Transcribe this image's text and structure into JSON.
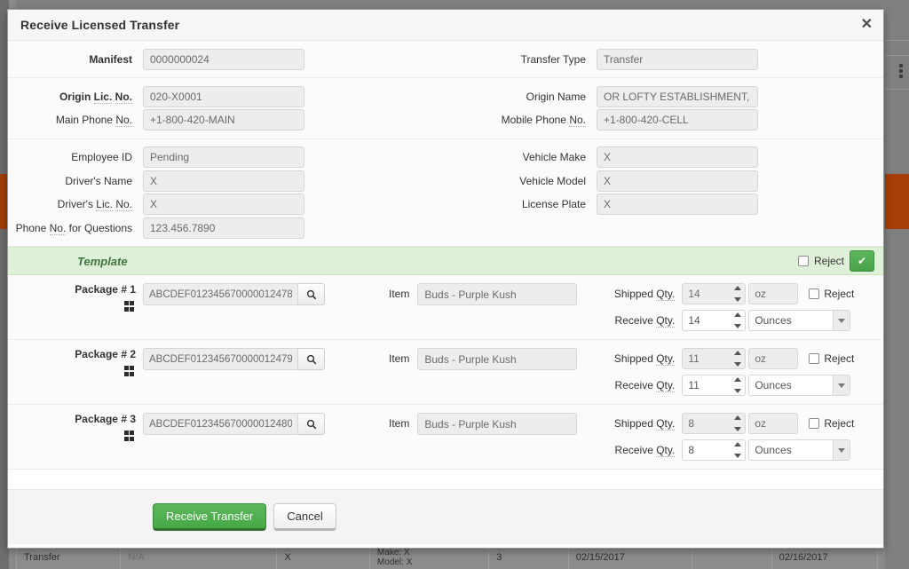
{
  "modal": {
    "title": "Receive Licensed Transfer",
    "close_label": "✕"
  },
  "form": {
    "rows": [
      {
        "left": [
          {
            "label": "Manifest",
            "bold": true,
            "value": "0000000024"
          }
        ],
        "right": [
          {
            "label": "Transfer Type",
            "bold": false,
            "value": "Transfer"
          }
        ]
      },
      {
        "left": [
          {
            "label": "Origin Lic. No.",
            "bold": true,
            "value": "020-X0001"
          },
          {
            "label": "Main Phone No.",
            "bold": false,
            "value": "+1-800-420-MAIN"
          }
        ],
        "right": [
          {
            "label": "Origin Name",
            "bold": false,
            "value": "OR LOFTY ESTABLISHMENT, LL"
          },
          {
            "label": "Mobile Phone No.",
            "bold": false,
            "value": "+1-800-420-CELL"
          }
        ]
      },
      {
        "left": [
          {
            "label": "Employee ID",
            "bold": false,
            "value": "Pending"
          },
          {
            "label": "Driver's Name",
            "bold": false,
            "value": "X"
          },
          {
            "label": "Driver's Lic. No.",
            "bold": false,
            "value": "X"
          },
          {
            "label": "Phone No. for Questions",
            "bold": false,
            "value": "123.456.7890"
          }
        ],
        "right": [
          {
            "label": "Vehicle Make",
            "bold": false,
            "value": "X"
          },
          {
            "label": "Vehicle Model",
            "bold": false,
            "value": "X"
          },
          {
            "label": "License Plate",
            "bold": false,
            "value": "X"
          }
        ]
      }
    ]
  },
  "template_bar": {
    "label": "Template",
    "reject_label": "Reject",
    "accept_icon": "✔",
    "accent_color": "#dff0d8",
    "accent_text_color": "#3c763d"
  },
  "packages": [
    {
      "number_label": "Package # 1",
      "tag_value": "ABCDEF012345670000012478",
      "search_icon": "search-icon",
      "item_label": "Item",
      "item_value": "Buds - Purple Kush",
      "shipped_label": "Shipped Qty.",
      "shipped_value": "14",
      "shipped_uom": "oz",
      "receive_label": "Receive Qty.",
      "receive_value": "14",
      "receive_uom": "Ounces",
      "reject_label": "Reject"
    },
    {
      "number_label": "Package # 2",
      "tag_value": "ABCDEF012345670000012479",
      "search_icon": "search-icon",
      "item_label": "Item",
      "item_value": "Buds - Purple Kush",
      "shipped_label": "Shipped Qty.",
      "shipped_value": "11",
      "shipped_uom": "oz",
      "receive_label": "Receive Qty.",
      "receive_value": "11",
      "receive_uom": "Ounces",
      "reject_label": "Reject"
    },
    {
      "number_label": "Package # 3",
      "tag_value": "ABCDEF012345670000012480",
      "search_icon": "search-icon",
      "item_label": "Item",
      "item_value": "Buds - Purple Kush",
      "shipped_label": "Shipped Qty.",
      "shipped_value": "8",
      "shipped_uom": "oz",
      "receive_label": "Receive Qty.",
      "receive_value": "8",
      "receive_uom": "Ounces",
      "reject_label": "Reject"
    }
  ],
  "footer": {
    "submit_label": "Receive Transfer",
    "cancel_label": "Cancel",
    "submit_color": "#5cb85c"
  },
  "background": {
    "accent_color": "#a93f08",
    "row": {
      "type": "Transfer",
      "na": "N/A",
      "driver": "X",
      "vehicle_make": "Make: X",
      "vehicle_model": "Model: X",
      "packages": "3",
      "date_1": "02/15/2017",
      "date_2": "02/16/2017"
    }
  }
}
